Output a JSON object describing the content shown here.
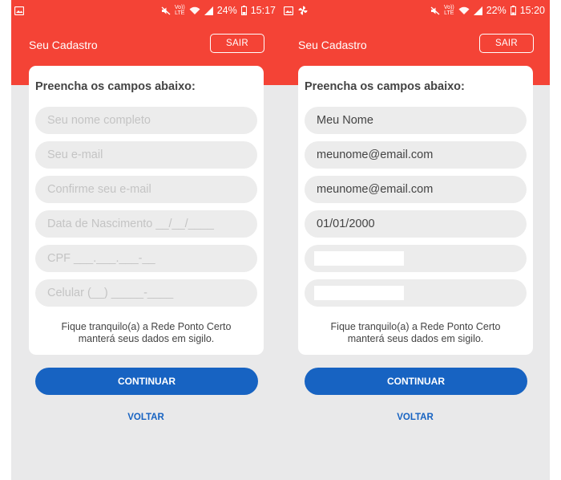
{
  "screens": [
    {
      "status_bar": {
        "battery": "24%",
        "time": "15:17",
        "network_top": "Vo))",
        "network_bottom": "LTE"
      },
      "app_bar": {
        "title": "Seu Cadastro",
        "logout_label": "SAIR"
      },
      "form": {
        "heading": "Preencha os campos abaixo:",
        "fields": [
          {
            "placeholder": "Seu nome completo",
            "value": ""
          },
          {
            "placeholder": "Seu e-mail",
            "value": ""
          },
          {
            "placeholder": "Confirme seu e-mail",
            "value": ""
          },
          {
            "placeholder": "Data de Nascimento __/__/____",
            "value": ""
          },
          {
            "placeholder": "CPF ___.___.___-__",
            "value": ""
          },
          {
            "placeholder": "Celular (__) _____-____",
            "value": ""
          }
        ],
        "note_line1": "Fique tranquilo(a) a Rede Ponto Certo",
        "note_line2": "manterá seus dados em sigilo."
      },
      "continue_label": "CONTINUAR",
      "back_label": "VOLTAR"
    },
    {
      "status_bar": {
        "battery": "22%",
        "time": "15:20",
        "network_top": "Vo))",
        "network_bottom": "LTE"
      },
      "app_bar": {
        "title": "Seu Cadastro",
        "logout_label": "SAIR"
      },
      "form": {
        "heading": "Preencha os campos abaixo:",
        "fields": [
          {
            "placeholder": "",
            "value": "Meu Nome"
          },
          {
            "placeholder": "",
            "value": "meunome@email.com"
          },
          {
            "placeholder": "",
            "value": "meunome@email.com"
          },
          {
            "placeholder": "",
            "value": "01/01/2000"
          },
          {
            "placeholder": "",
            "value": ""
          },
          {
            "placeholder": "",
            "value": ""
          }
        ],
        "note_line1": "Fique tranquilo(a) a Rede Ponto Certo",
        "note_line2": "manterá seus dados em sigilo."
      },
      "continue_label": "CONTINUAR",
      "back_label": "VOLTAR"
    }
  ],
  "colors": {
    "accent_red": "#f44336",
    "primary_blue": "#1763c2",
    "background": "#e9e9ea"
  },
  "icons": [
    "gallery-icon",
    "pinwheel-icon",
    "mute-icon",
    "wifi-icon",
    "signal-icon",
    "battery-icon"
  ]
}
